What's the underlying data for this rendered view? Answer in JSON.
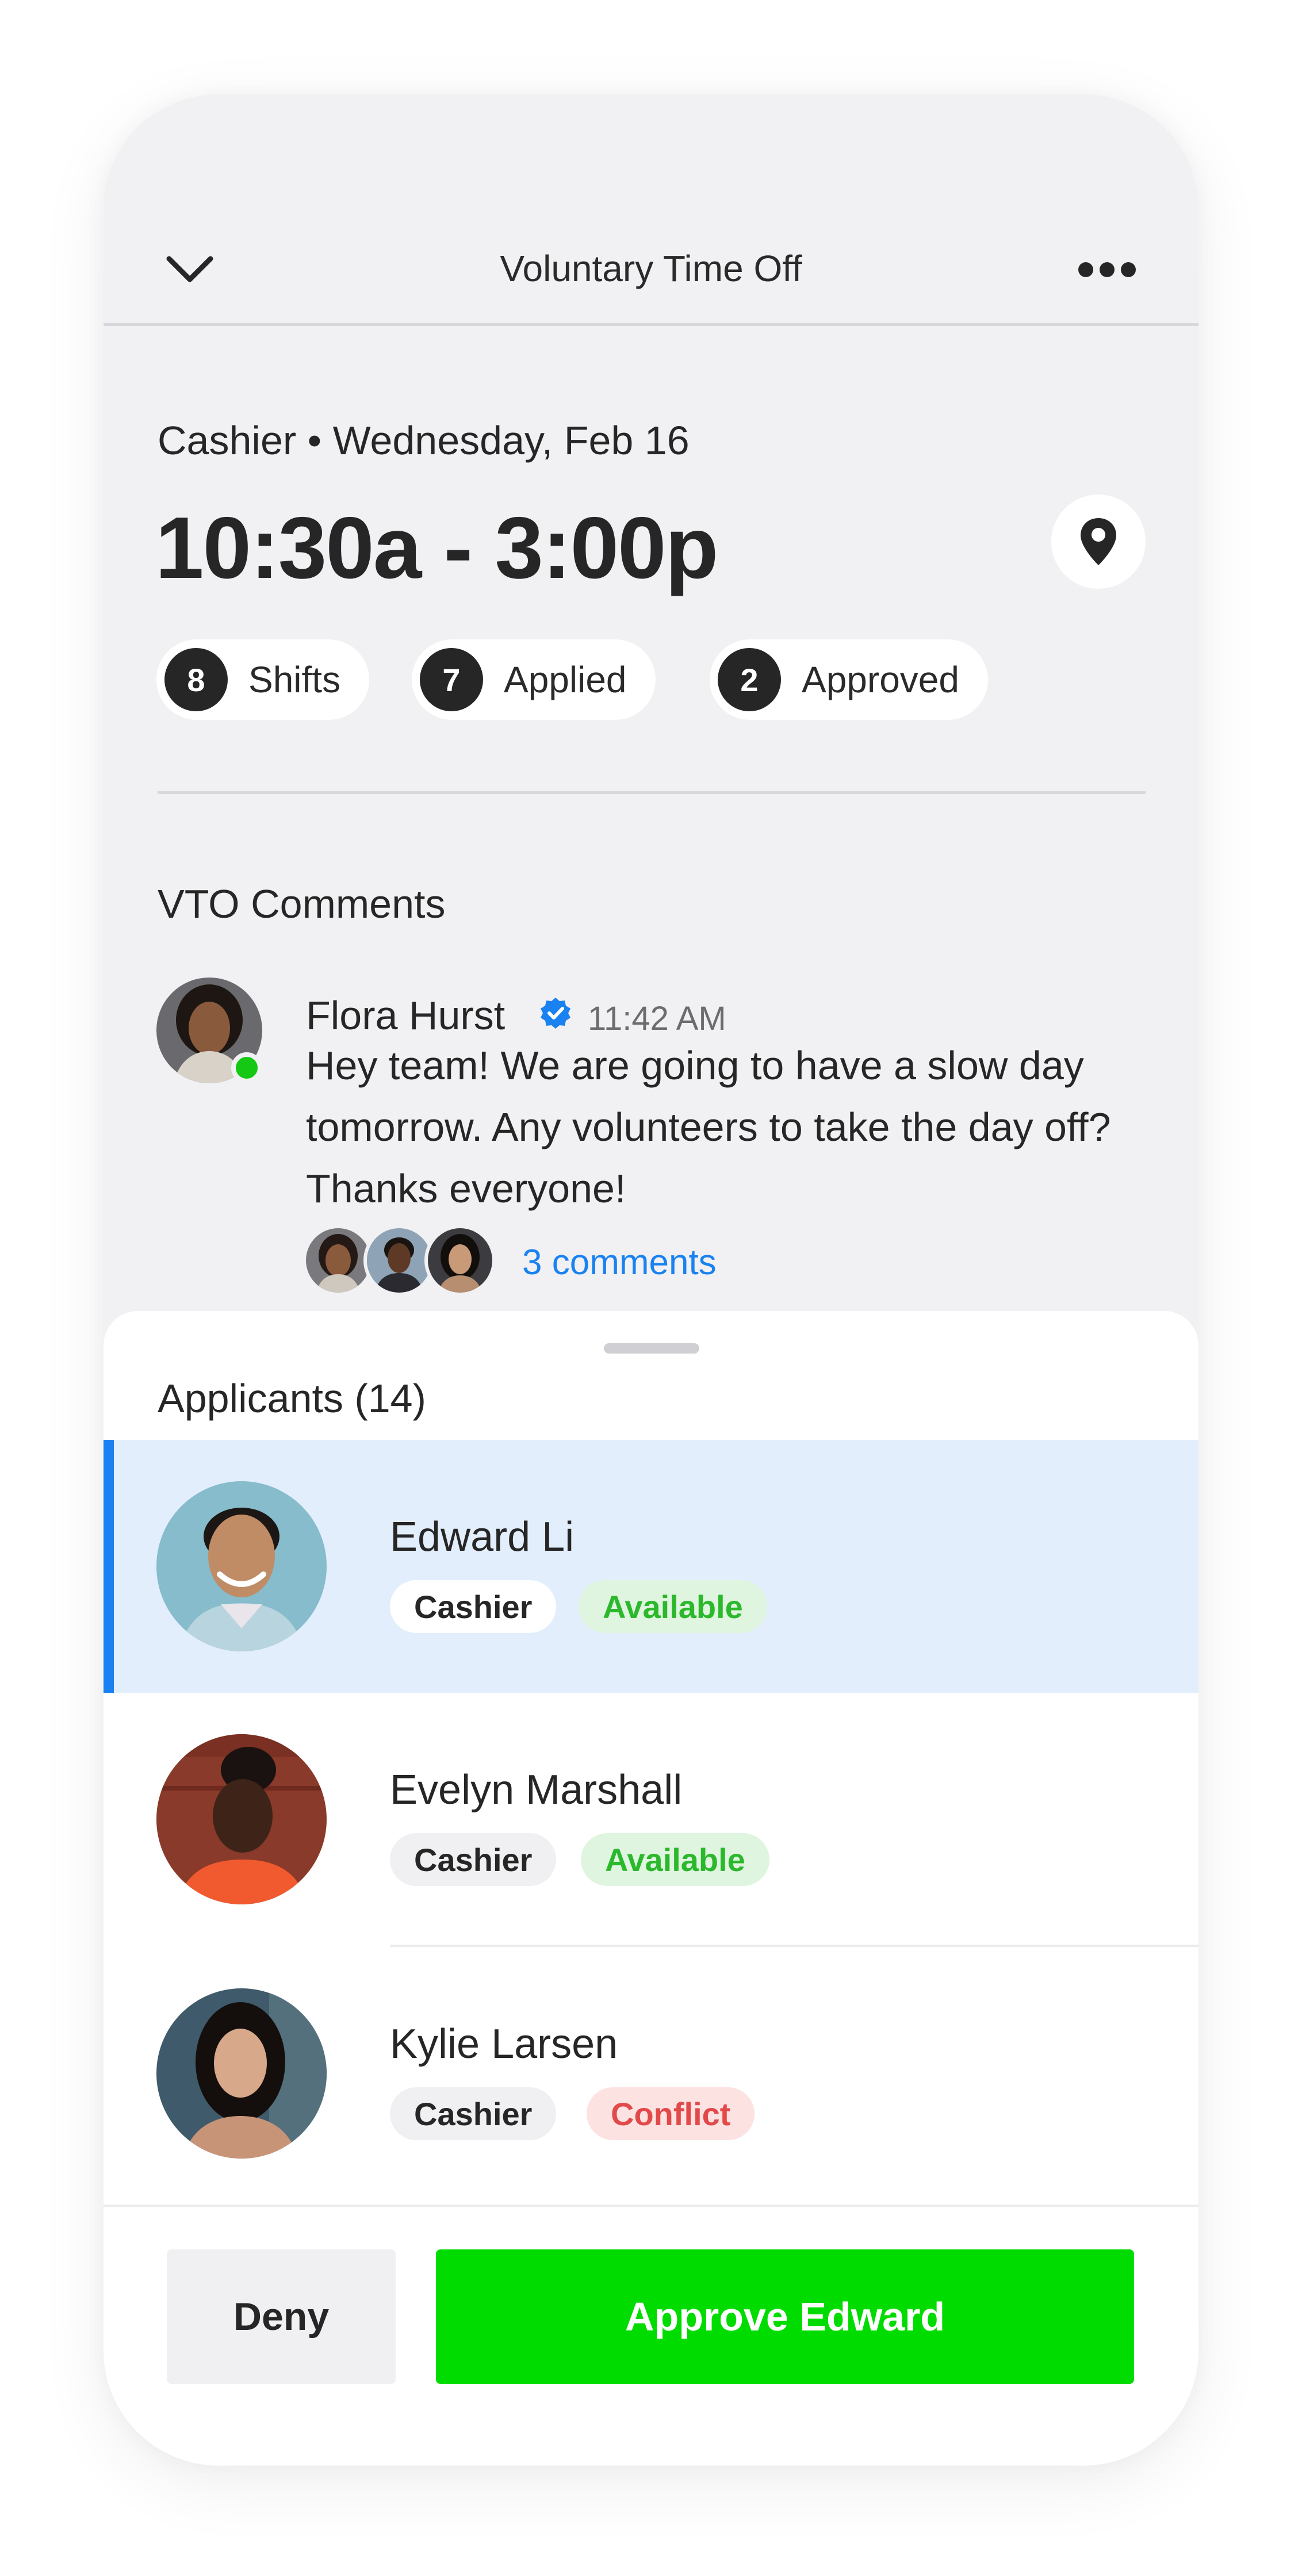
{
  "header": {
    "title": "Voluntary Time Off"
  },
  "shift": {
    "subtitle": "Cashier • Wednesday, Feb 16",
    "time": "10:30a - 3:00p",
    "stats": [
      {
        "count": "8",
        "label": "Shifts"
      },
      {
        "count": "7",
        "label": "Applied"
      },
      {
        "count": "2",
        "label": "Approved"
      }
    ]
  },
  "comments": {
    "title": "VTO Comments",
    "author": "Flora Hurst",
    "time": "11:42 AM",
    "body": "Hey team! We are going to have a slow day tomorrow. Any volunteers to take the day off? Thanks everyone!",
    "link": "3 comments"
  },
  "applicants": {
    "title": "Applicants (14)",
    "items": [
      {
        "name": "Edward Li",
        "role": "Cashier",
        "status": "Available",
        "selected": true
      },
      {
        "name": "Evelyn Marshall",
        "role": "Cashier",
        "status": "Available",
        "selected": false
      },
      {
        "name": "Kylie Larsen",
        "role": "Cashier",
        "status": "Conflict",
        "selected": false
      }
    ]
  },
  "actions": {
    "deny": "Deny",
    "approve": "Approve Edward"
  },
  "colors": {
    "accent": "#1a82f0",
    "approve": "#00dc00",
    "available": "#2cb82c",
    "conflict": "#e24a4a"
  }
}
